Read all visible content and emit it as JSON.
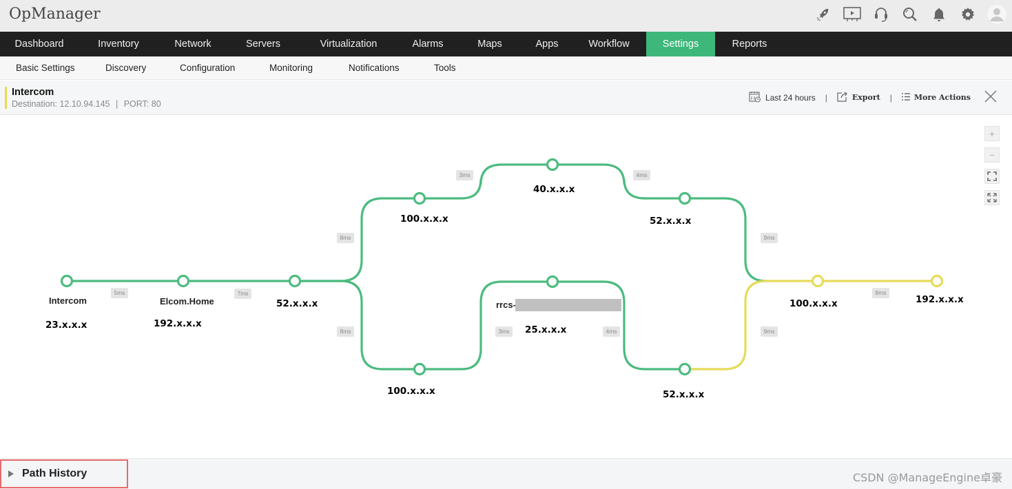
{
  "app": {
    "title": "OpManager"
  },
  "top_icons": [
    {
      "name": "rocket-icon"
    },
    {
      "name": "presentation-icon"
    },
    {
      "name": "headset-icon"
    },
    {
      "name": "search-icon"
    },
    {
      "name": "bell-icon"
    },
    {
      "name": "gear-icon"
    },
    {
      "name": "user-avatar-icon"
    }
  ],
  "main_nav": {
    "items": [
      {
        "label": "Dashboard",
        "active": false
      },
      {
        "label": "Inventory",
        "active": false
      },
      {
        "label": "Network",
        "active": false
      },
      {
        "label": "Servers",
        "active": false
      },
      {
        "label": "Virtualization",
        "active": false
      },
      {
        "label": "Alarms",
        "active": false
      },
      {
        "label": "Maps",
        "active": false
      },
      {
        "label": "Apps",
        "active": false
      },
      {
        "label": "Workflow",
        "active": false
      },
      {
        "label": "Settings",
        "active": true
      },
      {
        "label": "Reports",
        "active": false
      }
    ]
  },
  "sub_nav": {
    "items": [
      {
        "label": "Basic Settings"
      },
      {
        "label": "Discovery"
      },
      {
        "label": "Configuration"
      },
      {
        "label": "Monitoring"
      },
      {
        "label": "Notifications"
      },
      {
        "label": "Tools"
      }
    ]
  },
  "header": {
    "title": "Intercom",
    "destination_label": "Destination: 12.10.94.145",
    "separator": "|",
    "port_label": "PORT: 80",
    "time_range": "Last 24 hours",
    "export": "Export",
    "more_actions": "More Actions"
  },
  "zoom_controls": {
    "plus": "+",
    "minus": "−"
  },
  "colors": {
    "healthy": "#4cbb7f",
    "warning": "#e6db5a",
    "active_tab": "#3db77a",
    "highlight_border": "#e86a6a"
  },
  "path_graph": {
    "nodes": [
      {
        "id": "n1",
        "name": "Intercom",
        "ip": "23.x.x.x",
        "status": "healthy"
      },
      {
        "id": "n2",
        "name": "Elcom.Home",
        "ip": "192.x.x.x",
        "status": "healthy"
      },
      {
        "id": "n3",
        "name": "",
        "ip": "52.x.x.x",
        "status": "healthy"
      },
      {
        "id": "n4",
        "name": "",
        "ip": "100.x.x.x",
        "status": "healthy"
      },
      {
        "id": "n5",
        "name": "",
        "ip": "40.x.x.x",
        "status": "healthy"
      },
      {
        "id": "n6",
        "name": "",
        "ip": "52.x.x.x",
        "status": "healthy"
      },
      {
        "id": "n7",
        "name": "rrcs-",
        "ip": "25.x.x.x",
        "status": "healthy"
      },
      {
        "id": "n8",
        "name": "",
        "ip": "100.x.x.x",
        "status": "healthy"
      },
      {
        "id": "n9",
        "name": "",
        "ip": "52.x.x.x",
        "status": "healthy"
      },
      {
        "id": "n10",
        "name": "",
        "ip": "100.x.x.x",
        "status": "warning"
      },
      {
        "id": "n11",
        "name": "",
        "ip": "192.x.x.x",
        "status": "warning"
      }
    ],
    "latencies": [
      "5ms",
      "7ms",
      "8ms",
      "3ms",
      "4ms",
      "9ms",
      "8ms",
      "3ms",
      "4ms",
      "9ms",
      "8ms"
    ]
  },
  "footer": {
    "path_history": "Path History",
    "watermark": "CSDN @ManageEngine卓豪"
  }
}
